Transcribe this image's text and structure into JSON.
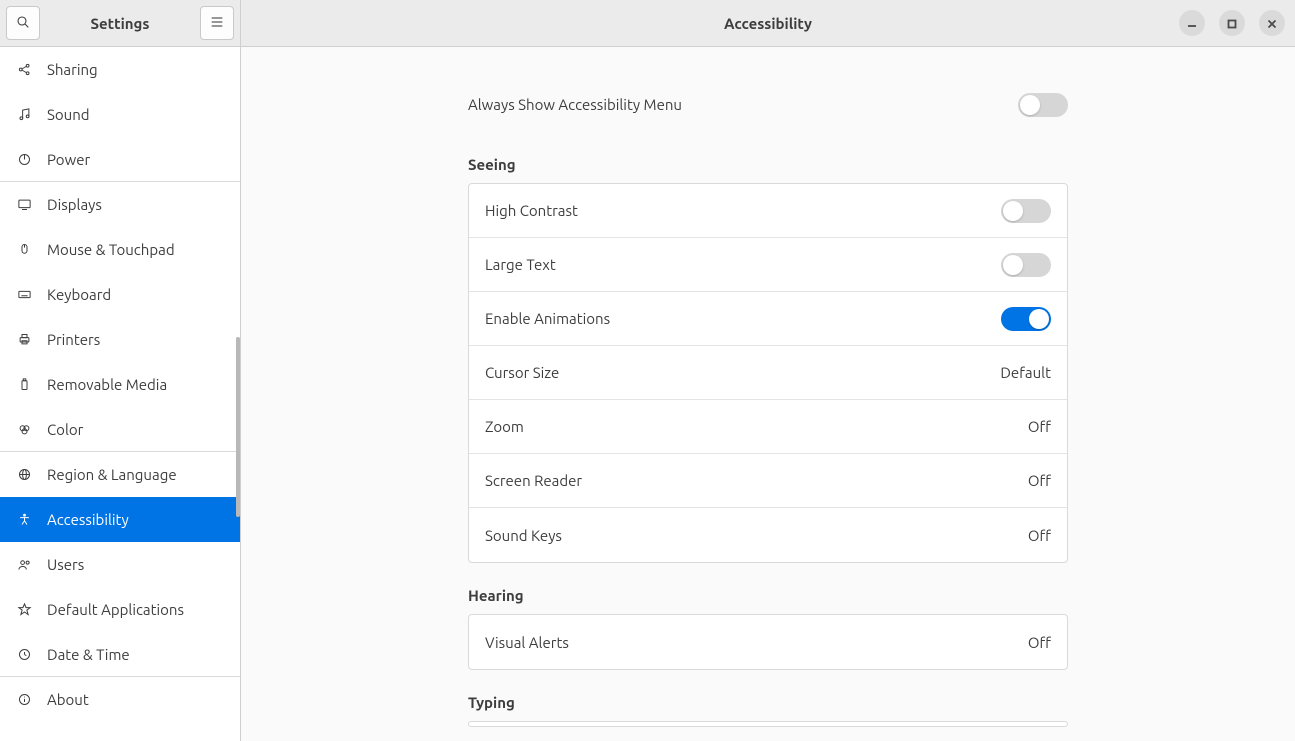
{
  "sidebar": {
    "title": "Settings",
    "items": [
      {
        "icon": "share-icon",
        "label": "Sharing"
      },
      {
        "icon": "music-note-icon",
        "label": "Sound"
      },
      {
        "icon": "power-icon",
        "label": "Power"
      },
      {
        "icon": "display-icon",
        "label": "Displays"
      },
      {
        "icon": "mouse-icon",
        "label": "Mouse & Touchpad"
      },
      {
        "icon": "keyboard-icon",
        "label": "Keyboard"
      },
      {
        "icon": "printer-icon",
        "label": "Printers"
      },
      {
        "icon": "usb-icon",
        "label": "Removable Media"
      },
      {
        "icon": "color-icon",
        "label": "Color"
      },
      {
        "icon": "globe-icon",
        "label": "Region & Language"
      },
      {
        "icon": "accessibility-icon",
        "label": "Accessibility"
      },
      {
        "icon": "users-icon",
        "label": "Users"
      },
      {
        "icon": "star-icon",
        "label": "Default Applications"
      },
      {
        "icon": "clock-icon",
        "label": "Date & Time"
      },
      {
        "icon": "info-icon",
        "label": "About"
      }
    ]
  },
  "main": {
    "title": "Accessibility",
    "always_show_menu": {
      "label": "Always Show Accessibility Menu",
      "on": false
    },
    "sections": {
      "seeing": {
        "title": "Seeing",
        "rows": [
          {
            "label": "High Contrast",
            "type": "toggle",
            "on": false
          },
          {
            "label": "Large Text",
            "type": "toggle",
            "on": false
          },
          {
            "label": "Enable Animations",
            "type": "toggle",
            "on": true
          },
          {
            "label": "Cursor Size",
            "type": "value",
            "value": "Default"
          },
          {
            "label": "Zoom",
            "type": "value",
            "value": "Off"
          },
          {
            "label": "Screen Reader",
            "type": "value",
            "value": "Off"
          },
          {
            "label": "Sound Keys",
            "type": "value",
            "value": "Off"
          }
        ]
      },
      "hearing": {
        "title": "Hearing",
        "rows": [
          {
            "label": "Visual Alerts",
            "type": "value",
            "value": "Off"
          }
        ]
      },
      "typing": {
        "title": "Typing"
      }
    }
  }
}
